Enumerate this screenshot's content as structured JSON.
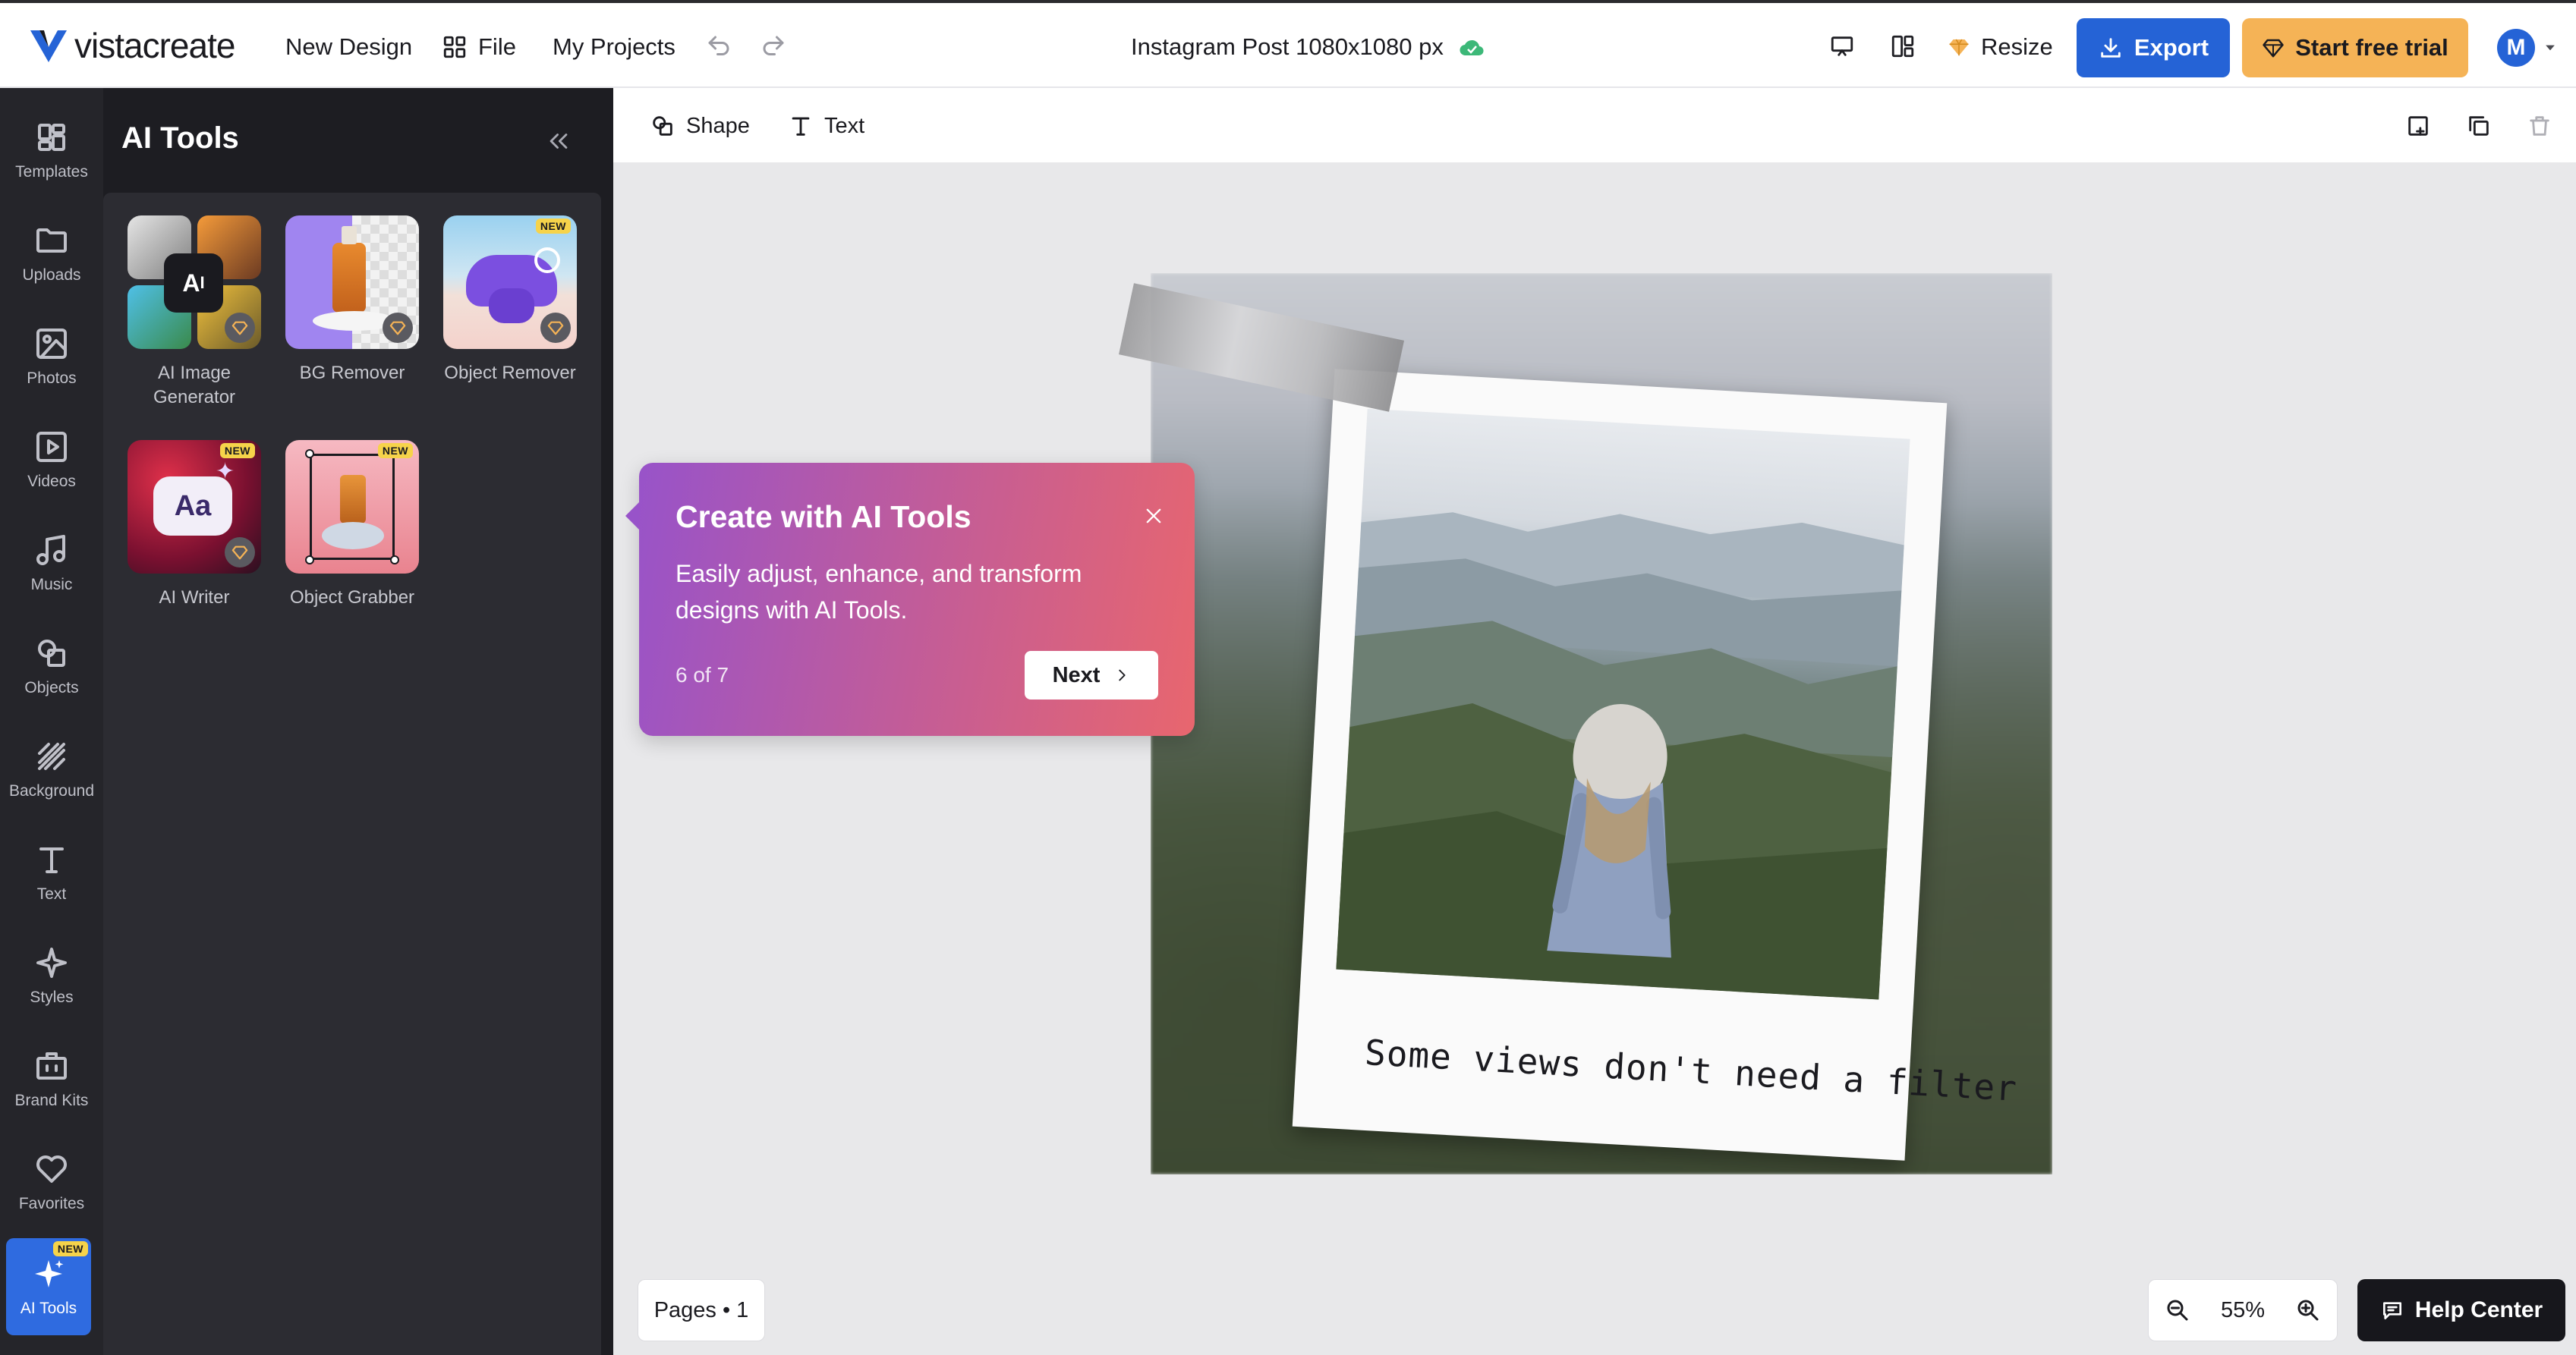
{
  "header": {
    "brand": "vistacreate",
    "new_design": "New Design",
    "file": "File",
    "my_projects": "My Projects",
    "doc_title": "Instagram Post 1080x1080 px",
    "resize": "Resize",
    "export": "Export",
    "start_trial": "Start free trial",
    "avatar_initial": "M"
  },
  "rail": {
    "items": [
      {
        "label": "Templates",
        "icon": "templates-icon"
      },
      {
        "label": "Uploads",
        "icon": "folder-icon"
      },
      {
        "label": "Photos",
        "icon": "photo-icon"
      },
      {
        "label": "Videos",
        "icon": "video-icon"
      },
      {
        "label": "Music",
        "icon": "music-icon"
      },
      {
        "label": "Objects",
        "icon": "objects-icon"
      },
      {
        "label": "Background",
        "icon": "background-icon"
      },
      {
        "label": "Text",
        "icon": "text-icon"
      },
      {
        "label": "Styles",
        "icon": "sparkle-icon"
      },
      {
        "label": "Brand Kits",
        "icon": "briefcase-icon"
      },
      {
        "label": "Favorites",
        "icon": "heart-icon"
      },
      {
        "label": "AI Tools",
        "icon": "ai-sparkle-icon",
        "badge": "NEW"
      }
    ]
  },
  "panel": {
    "title": "AI Tools",
    "tools": [
      {
        "label": "AI Image Generator",
        "premium": true
      },
      {
        "label": "BG Remover",
        "premium": true
      },
      {
        "label": "Object Remover",
        "premium": true,
        "badge": "NEW"
      },
      {
        "label": "AI Writer",
        "premium": true,
        "badge": "NEW"
      },
      {
        "label": "Object Grabber",
        "badge": "NEW"
      }
    ]
  },
  "toolbar": {
    "shape": "Shape",
    "text": "Text"
  },
  "canvas": {
    "caption": "Some views don't need a filter"
  },
  "popover": {
    "title": "Create with AI Tools",
    "description": "Easily adjust, enhance, and transform designs with AI Tools.",
    "step": "6 of 7",
    "next": "Next"
  },
  "footer": {
    "pages": "Pages • 1",
    "zoom": "55%",
    "help": "Help Center"
  },
  "colors": {
    "accent": "#2563d6",
    "trial": "#f5b356",
    "rail": "#25252a",
    "panel": "#1d1d22"
  }
}
